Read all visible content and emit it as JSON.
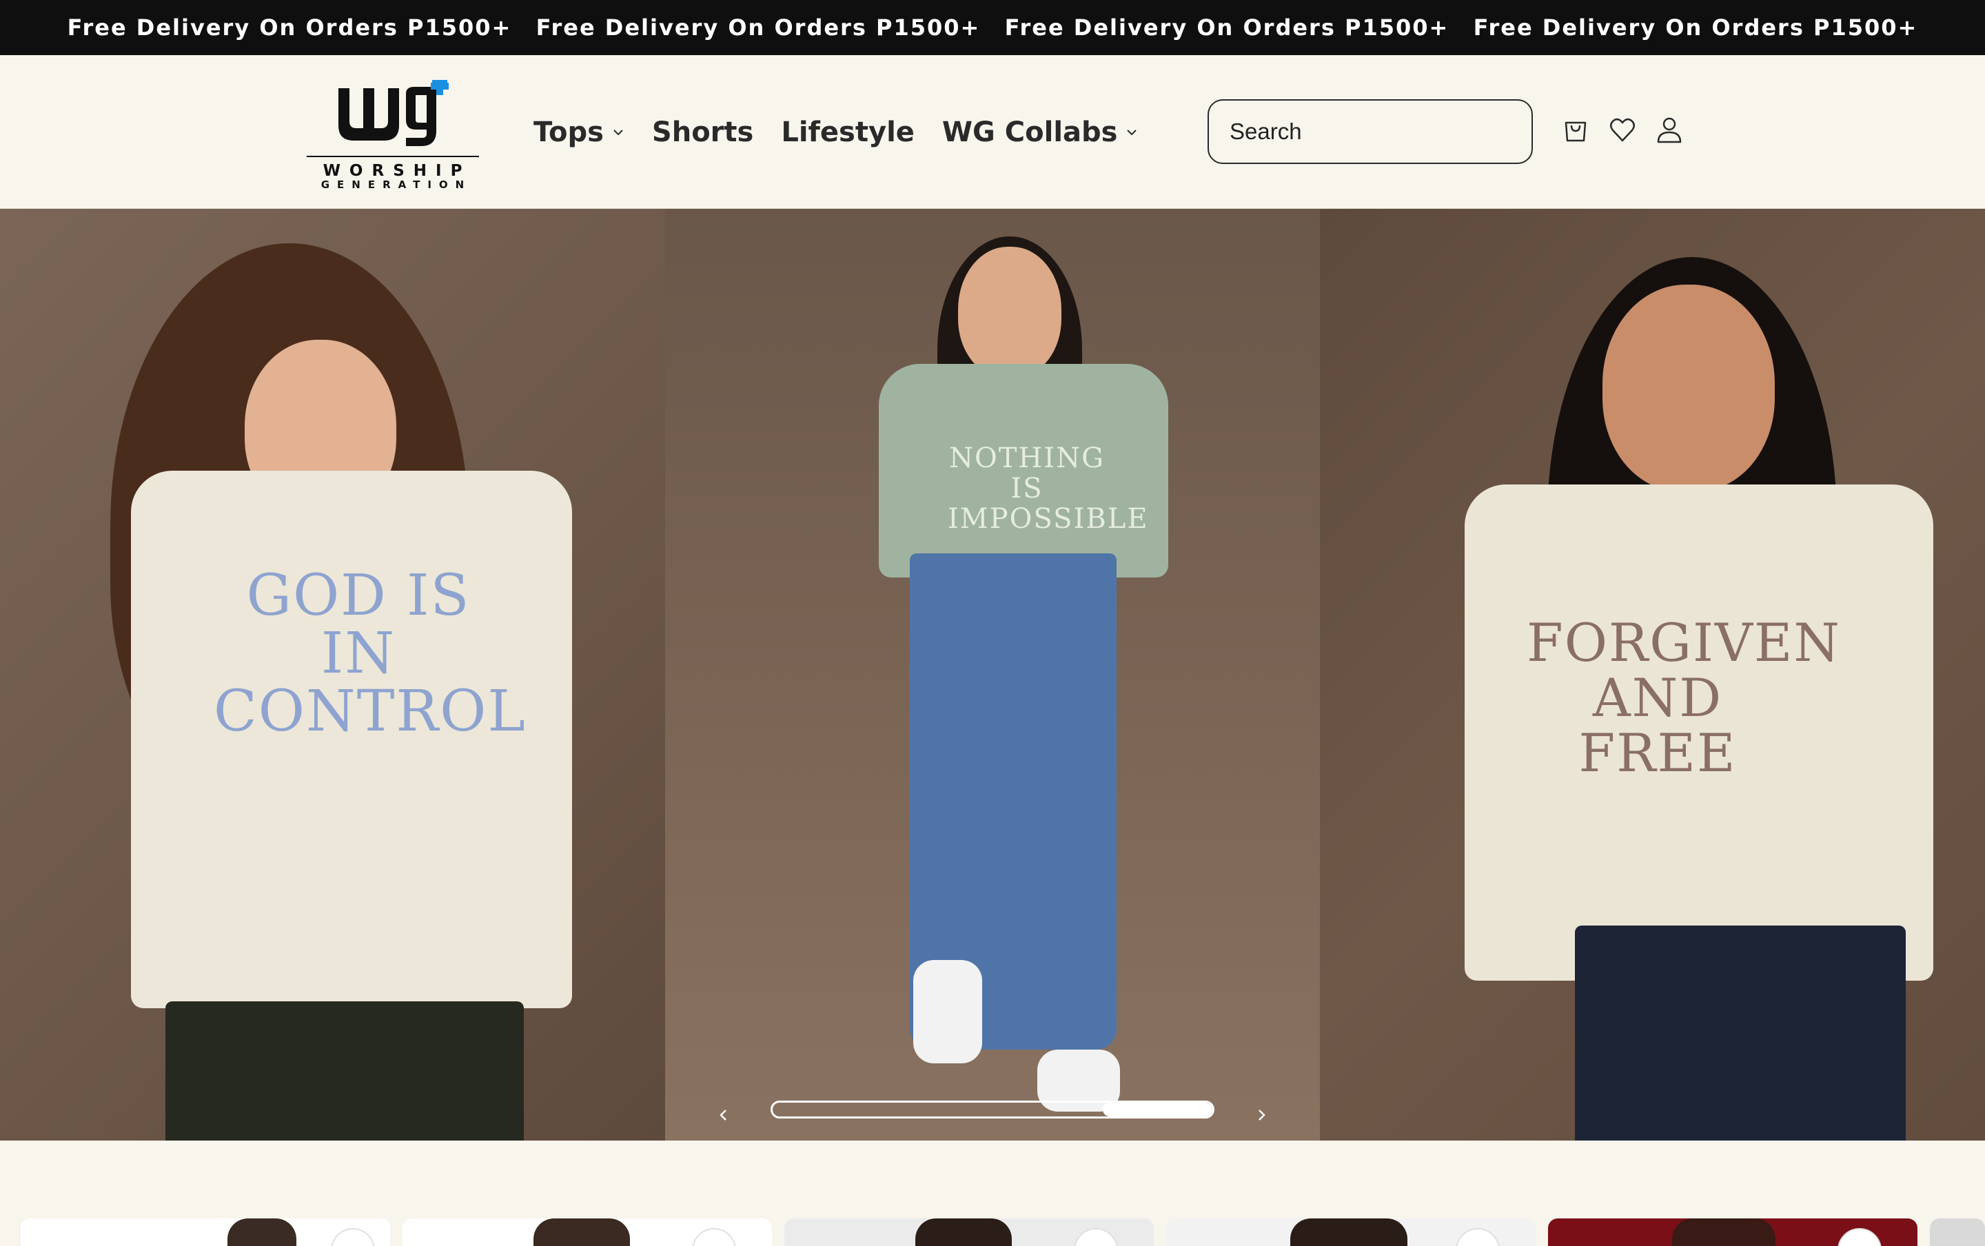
{
  "announcement": {
    "messages": [
      "Free Delivery On Orders P1500+",
      "Free Delivery On Orders P1500+",
      "Free Delivery On Orders P1500+",
      "Free Delivery On Orders P1500+"
    ]
  },
  "header": {
    "logo": {
      "line1": "WORSHIP",
      "line2": "GENERATION"
    },
    "nav": [
      {
        "label": "Tops",
        "has_dropdown": true
      },
      {
        "label": "Shorts",
        "has_dropdown": false
      },
      {
        "label": "Lifestyle",
        "has_dropdown": false
      },
      {
        "label": "WG Collabs",
        "has_dropdown": true
      }
    ],
    "search": {
      "placeholder": "Search"
    },
    "icons": [
      "cart-icon",
      "heart-icon",
      "account-icon"
    ]
  },
  "hero": {
    "slides": [
      {
        "tee_text": "GOD IS IN CONTROL",
        "tee_color": "#ece7d8",
        "text_color": "#8ea3cf"
      },
      {
        "tee_text": "NOTHING IS IMPOSSIBLE",
        "tee_color": "#9fb3a0",
        "text_color": "#e6ece0"
      },
      {
        "tee_text": "FORGIVEN AND FREE",
        "tee_color": "#ebe5d6",
        "text_color": "#8a6f66"
      }
    ],
    "slideshow_progress": 0.25,
    "controls": {
      "prev_icon": "chevron-left-icon",
      "next_icon": "chevron-right-icon"
    }
  },
  "colors": {
    "announcement_bg": "#0f0f0f",
    "page_bg": "#f8f5ed",
    "text": "#2a2a2a",
    "accent_blue": "#1a8fe0"
  }
}
